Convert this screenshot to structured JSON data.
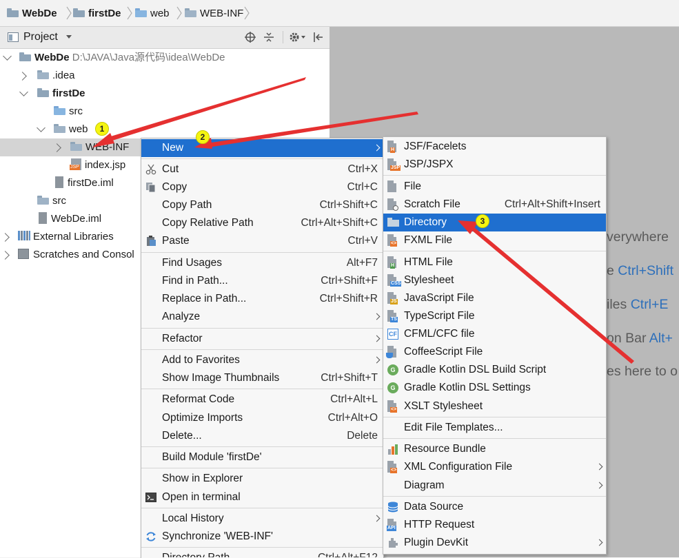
{
  "breadcrumb": [
    "WebDe",
    "firstDe",
    "web",
    "WEB-INF"
  ],
  "toolbar": {
    "view_label": "Project"
  },
  "tree": {
    "root_name": "WebDe",
    "root_path": "D:\\JAVA\\Java源代码\\idea\\WebDe",
    "idea": ".idea",
    "firstDe": "firstDe",
    "src1": "src",
    "web": "web",
    "webinf": "WEB-INF",
    "indexjsp": "index.jsp",
    "firstDeIml": "firstDe.iml",
    "src2": "src",
    "webDeIml": "WebDe.iml",
    "extlibs": "External Libraries",
    "scratches": "Scratches and Consol"
  },
  "context_menu": [
    {
      "label": "New",
      "shortcut": "",
      "submenu": true
    },
    {
      "label": "Cut",
      "shortcut": "Ctrl+X"
    },
    {
      "label": "Copy",
      "shortcut": "Ctrl+C"
    },
    {
      "label": "Copy Path",
      "shortcut": "Ctrl+Shift+C"
    },
    {
      "label": "Copy Relative Path",
      "shortcut": "Ctrl+Alt+Shift+C"
    },
    {
      "label": "Paste",
      "shortcut": "Ctrl+V"
    },
    {
      "label": "Find Usages",
      "shortcut": "Alt+F7"
    },
    {
      "label": "Find in Path...",
      "shortcut": "Ctrl+Shift+F"
    },
    {
      "label": "Replace in Path...",
      "shortcut": "Ctrl+Shift+R"
    },
    {
      "label": "Analyze",
      "shortcut": "",
      "submenu": true
    },
    {
      "label": "Refactor",
      "shortcut": "",
      "submenu": true
    },
    {
      "label": "Add to Favorites",
      "shortcut": "",
      "submenu": true
    },
    {
      "label": "Show Image Thumbnails",
      "shortcut": "Ctrl+Shift+T"
    },
    {
      "label": "Reformat Code",
      "shortcut": "Ctrl+Alt+L"
    },
    {
      "label": "Optimize Imports",
      "shortcut": "Ctrl+Alt+O"
    },
    {
      "label": "Delete...",
      "shortcut": "Delete"
    },
    {
      "label": "Build Module 'firstDe'",
      "shortcut": ""
    },
    {
      "label": "Show in Explorer",
      "shortcut": ""
    },
    {
      "label": "Open in terminal",
      "shortcut": ""
    },
    {
      "label": "Local History",
      "shortcut": "",
      "submenu": true
    },
    {
      "label": "Synchronize 'WEB-INF'",
      "shortcut": ""
    },
    {
      "label": "Directory Path",
      "shortcut": "Ctrl+Alt+F12"
    }
  ],
  "new_submenu": [
    {
      "label": "JSF/Facelets",
      "shortcut": "",
      "badge": "H"
    },
    {
      "label": "JSP/JSPX",
      "shortcut": "",
      "badge": "JSP"
    },
    {
      "label": "File",
      "shortcut": ""
    },
    {
      "label": "Scratch File",
      "shortcut": "Ctrl+Alt+Shift+Insert"
    },
    {
      "label": "Directory",
      "shortcut": ""
    },
    {
      "label": "FXML File",
      "shortcut": "",
      "badge": "<>"
    },
    {
      "label": "HTML File",
      "shortcut": "",
      "badge": "H"
    },
    {
      "label": "Stylesheet",
      "shortcut": "",
      "badge": "CSS"
    },
    {
      "label": "JavaScript File",
      "shortcut": "",
      "badge": "JS"
    },
    {
      "label": "TypeScript File",
      "shortcut": "",
      "badge": "TS"
    },
    {
      "label": "CFML/CFC file",
      "shortcut": "",
      "badge": "CF"
    },
    {
      "label": "CoffeeScript File",
      "shortcut": ""
    },
    {
      "label": "Gradle Kotlin DSL Build Script",
      "shortcut": "",
      "badge": "G"
    },
    {
      "label": "Gradle Kotlin DSL Settings",
      "shortcut": "",
      "badge": "G"
    },
    {
      "label": "XSLT Stylesheet",
      "shortcut": "",
      "badge": "<>"
    },
    {
      "label": "Edit File Templates...",
      "shortcut": ""
    },
    {
      "label": "Resource Bundle",
      "shortcut": ""
    },
    {
      "label": "XML Configuration File",
      "shortcut": "",
      "submenu": true,
      "badge": "<>"
    },
    {
      "label": "Diagram",
      "shortcut": "",
      "submenu": true
    },
    {
      "label": "Data Source",
      "shortcut": ""
    },
    {
      "label": "HTTP Request",
      "shortcut": "",
      "badge": "API"
    },
    {
      "label": "Plugin DevKit",
      "shortcut": "",
      "submenu": true
    }
  ],
  "editor_hints": [
    {
      "text": "verywhere",
      "key": ""
    },
    {
      "text": "e ",
      "key": "Ctrl+Shift"
    },
    {
      "text": "iles ",
      "key": "Ctrl+E"
    },
    {
      "text": "on Bar ",
      "key": "Alt+"
    },
    {
      "text": "es here to o",
      "key": ""
    }
  ],
  "annotations": [
    "1",
    "2",
    "3"
  ],
  "colors": {
    "highlight": "#1f6fcf",
    "arrow": "#e53030",
    "marker": "#f5f511"
  }
}
